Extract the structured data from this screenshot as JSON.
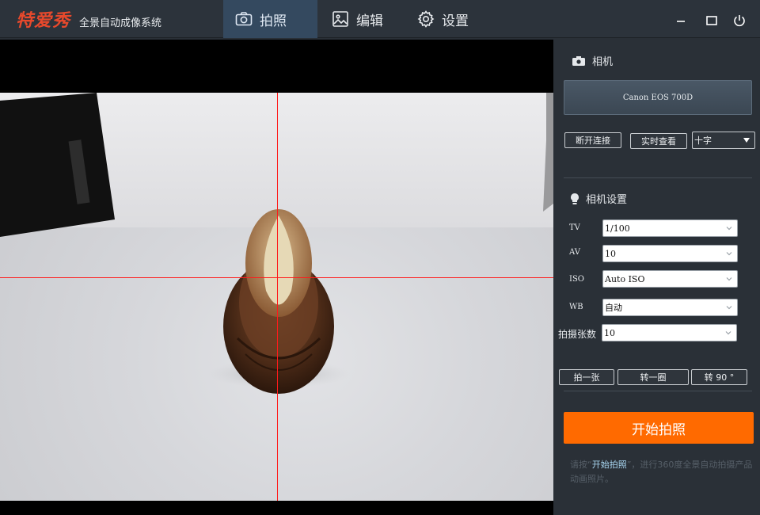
{
  "app": {
    "logo": "特爱秀",
    "subtitle": "全景自动成像系统"
  },
  "nav": {
    "tabs": [
      {
        "label": "拍照",
        "icon": "camera-icon",
        "active": true
      },
      {
        "label": "编辑",
        "icon": "image-edit-icon",
        "active": false
      },
      {
        "label": "设置",
        "icon": "gear-icon",
        "active": false
      }
    ]
  },
  "window_controls": [
    "minimize-icon",
    "maximize-icon",
    "power-icon"
  ],
  "camera": {
    "section_title": "相机",
    "model": "Canon EOS 700D",
    "disconnect_label": "断开连接",
    "liveview_label": "实时查看",
    "overlay_value": "十字"
  },
  "settings": {
    "section_title": "相机设置",
    "rows": [
      {
        "label": "TV",
        "value": "1/100"
      },
      {
        "label": "AV",
        "value": "10"
      },
      {
        "label": "ISO",
        "value": "Auto ISO"
      },
      {
        "label": "WB",
        "value": "自动"
      },
      {
        "label": "拍摄张数",
        "value": "10"
      }
    ]
  },
  "actions": {
    "shoot_one": "拍一张",
    "rotate_circle": "转一圈",
    "rotate_90": "转 90 °",
    "start": "开始拍照"
  },
  "hint": {
    "before": "请按“",
    "keyword": "开始拍照",
    "after": "”，进行360度全景自动拍摄产品动画照片。"
  },
  "colors": {
    "accent": "#ff6a00",
    "crosshair": "#ff1a1a",
    "panel": "#2a3037",
    "active_tab": "#34495f",
    "logo": "#e8492c"
  }
}
